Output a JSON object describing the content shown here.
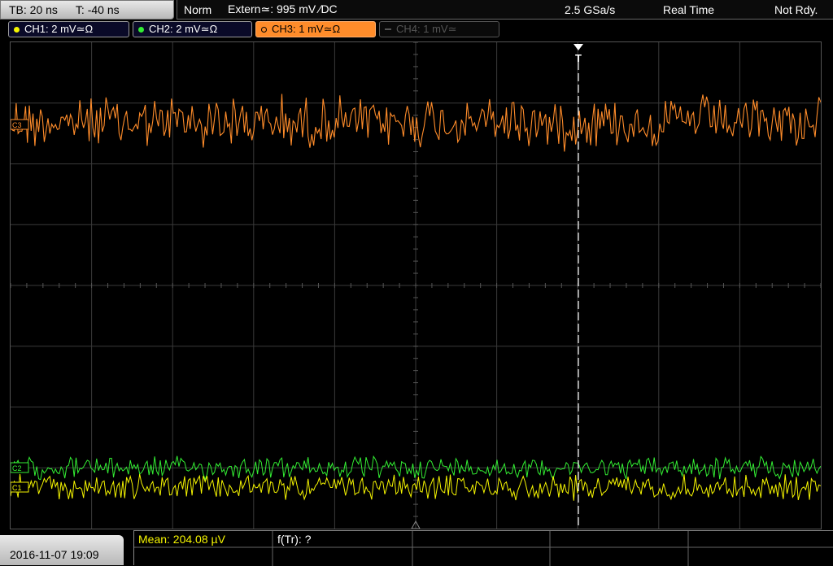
{
  "header": {
    "timebase": "TB: 20 ns",
    "trigger_time": "T: -40 ns",
    "trigger_mode": "Norm",
    "trigger_source": "Extern≃: 995 mV ∕DC",
    "sample_rate": "2.5 GSa/s",
    "acq_mode": "Real Time",
    "status": "Not Rdy."
  },
  "channels": [
    {
      "label": "CH1: 2 mV≃Ω",
      "color": "#f5f500",
      "active": true
    },
    {
      "label": "CH2: 2 mV≃Ω",
      "color": "#33ee33",
      "active": true
    },
    {
      "label": "CH3: 1 mV≃Ω",
      "color": "#ff8c2a",
      "active": true,
      "selected": true
    },
    {
      "label": "CH4: 1 mV≃",
      "color": "#555555",
      "active": false
    }
  ],
  "markers": {
    "ch3": "C3",
    "ch2": "C2",
    "ch1": "C1",
    "trigger": "T"
  },
  "footer": {
    "datetime": "2016-11-07 19:09",
    "mean": "Mean: 204.08 µV",
    "freq": "f(Tr): ?"
  },
  "colors": {
    "ch1": "#f5f500",
    "ch2": "#33ee33",
    "ch3": "#ff8c2a",
    "grid": "#3a3a3a",
    "measure_text": "#f5f500"
  }
}
